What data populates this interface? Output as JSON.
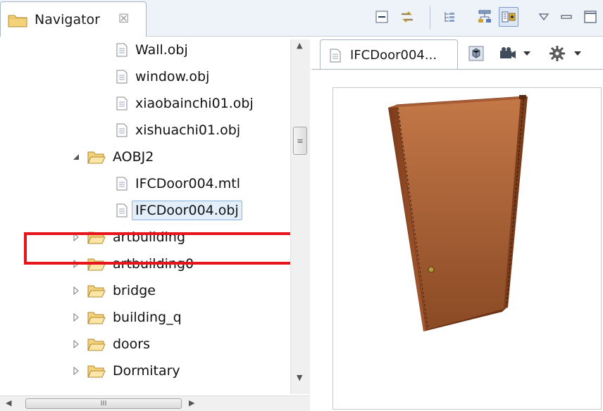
{
  "navigator": {
    "tab_label": "Navigator",
    "close_glyph": "☒",
    "items": [
      {
        "label": "Wall.obj",
        "type": "file",
        "depth": 2
      },
      {
        "label": "window.obj",
        "type": "file",
        "depth": 2
      },
      {
        "label": "xiaobainchi01.obj",
        "type": "file",
        "depth": 2
      },
      {
        "label": "xishuachi01.obj",
        "type": "file",
        "depth": 2
      },
      {
        "label": "AOBJ2",
        "type": "folder",
        "depth": 1,
        "expanded": true
      },
      {
        "label": "IFCDoor004.mtl",
        "type": "file",
        "depth": 2
      },
      {
        "label": "IFCDoor004.obj",
        "type": "file",
        "depth": 2,
        "selected": true
      },
      {
        "label": "artbuilding",
        "type": "folder",
        "depth": 1,
        "expanded": false
      },
      {
        "label": "artbuilding0",
        "type": "folder",
        "depth": 1,
        "expanded": false
      },
      {
        "label": "bridge",
        "type": "folder",
        "depth": 1,
        "expanded": false
      },
      {
        "label": "building_q",
        "type": "folder",
        "depth": 1,
        "expanded": false
      },
      {
        "label": "doors",
        "type": "folder",
        "depth": 1,
        "expanded": false
      },
      {
        "label": "Dormitary",
        "type": "folder",
        "depth": 1,
        "expanded": false
      }
    ],
    "toolbar_icons": [
      "collapse-all-icon",
      "link-with-editor-icon",
      "tree-layout-icon",
      "hierarchy-icon",
      "view-mode-icon",
      "view-menu-icon",
      "minimize-icon",
      "maximize-icon"
    ],
    "scrollbar_grip": "≡",
    "hscroll_grip": "III"
  },
  "editor": {
    "tab_label": "IFCDoor004...",
    "toolbar_icons": [
      "cube-view-icon",
      "camera-icon",
      "dropdown-icon",
      "settings-icon",
      "dropdown-icon"
    ]
  },
  "colors": {
    "selection_highlight": "#e8141b",
    "door_light": "#c97a48",
    "door_dark": "#8a4520",
    "folder_fill": "#f3d27a"
  }
}
